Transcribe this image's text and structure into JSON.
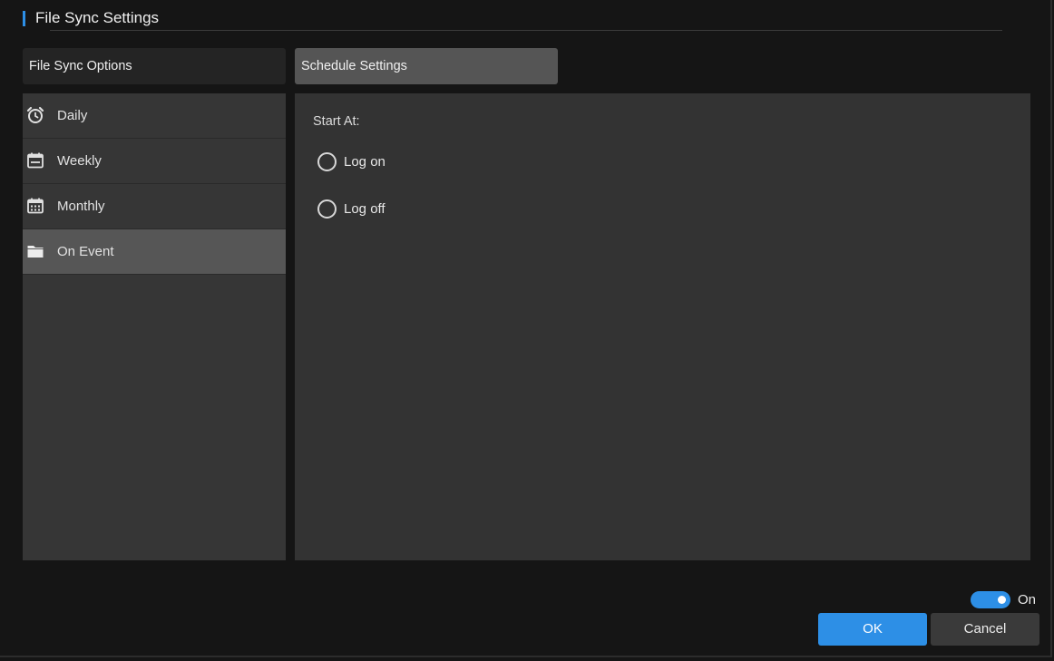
{
  "window": {
    "title": "File Sync Settings"
  },
  "tabs": [
    {
      "label": "File Sync Options",
      "active": false
    },
    {
      "label": "Schedule Settings",
      "active": true
    }
  ],
  "sidebar": {
    "items": [
      {
        "label": "Daily",
        "icon": "alarm-clock-icon",
        "active": false
      },
      {
        "label": "Weekly",
        "icon": "calendar-week-icon",
        "active": false
      },
      {
        "label": "Monthly",
        "icon": "calendar-month-icon",
        "active": false
      },
      {
        "label": "On Event",
        "icon": "folder-icon",
        "active": true
      }
    ]
  },
  "content": {
    "start_label": "Start At:",
    "options": [
      {
        "label": "Log on",
        "selected": false
      },
      {
        "label": "Log off",
        "selected": false
      }
    ]
  },
  "footer": {
    "toggle_label": "On",
    "toggle_on": true,
    "ok_label": "OK",
    "cancel_label": "Cancel"
  },
  "colors": {
    "accent": "#2d8fe6",
    "background": "#151515",
    "panel": "#333333",
    "active_item": "#565656"
  }
}
